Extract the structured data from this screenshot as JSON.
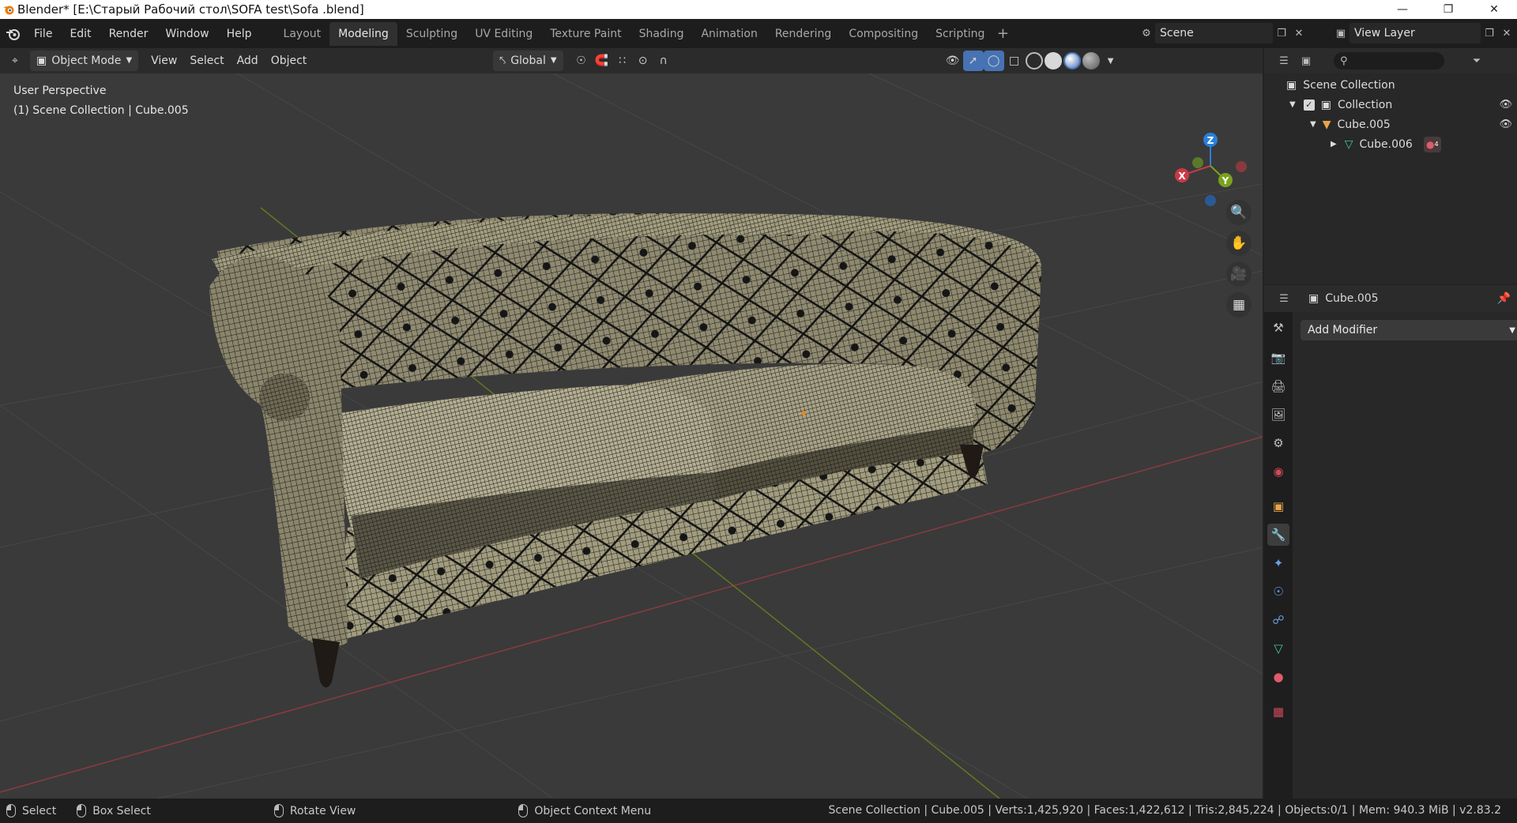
{
  "window": {
    "title": "Blender* [E:\\Старый Рабочий стол\\SOFA test\\Sofa .blend]",
    "controls": [
      "minimize-icon",
      "restore-icon",
      "close-icon"
    ]
  },
  "topbar": {
    "menus": [
      "File",
      "Edit",
      "Render",
      "Window",
      "Help"
    ],
    "workspaces": [
      "Layout",
      "Modeling",
      "Sculpting",
      "UV Editing",
      "Texture Paint",
      "Shading",
      "Animation",
      "Rendering",
      "Compositing",
      "Scripting"
    ],
    "active_workspace": "Modeling",
    "add_workspace": "+",
    "scene_label": "Scene",
    "view_layer_label": "View Layer"
  },
  "viewport": {
    "mode": "Object Mode",
    "menus": [
      "View",
      "Select",
      "Add",
      "Object"
    ],
    "transform_orientation": "Global",
    "overlay_line1": "User Perspective",
    "overlay_line2": "(1) Scene Collection | Cube.005",
    "gizmo_axes": {
      "x": "X",
      "y": "Y",
      "z": "Z"
    },
    "colors": {
      "x_axis": "#c83a46",
      "y_axis": "#7aa21c",
      "z_axis": "#2a7fdc",
      "background": "#3a3a3a",
      "grid": "#474747"
    }
  },
  "outliner": {
    "root": "Scene Collection",
    "collection": "Collection",
    "object": "Cube.005",
    "child_mesh": "Cube.006",
    "material_badge": "4"
  },
  "properties": {
    "object_name": "Cube.005",
    "add_modifier_label": "Add Modifier",
    "active_tab": "modifier"
  },
  "statusbar": {
    "select": "Select",
    "box_select": "Box Select",
    "rotate_view": "Rotate View",
    "context_menu": "Object Context Menu",
    "stats": "Scene Collection | Cube.005 | Verts:1,425,920 | Faces:1,422,612 | Tris:2,845,224 | Objects:0/1 | Mem: 940.3 MiB | v2.83.2"
  }
}
